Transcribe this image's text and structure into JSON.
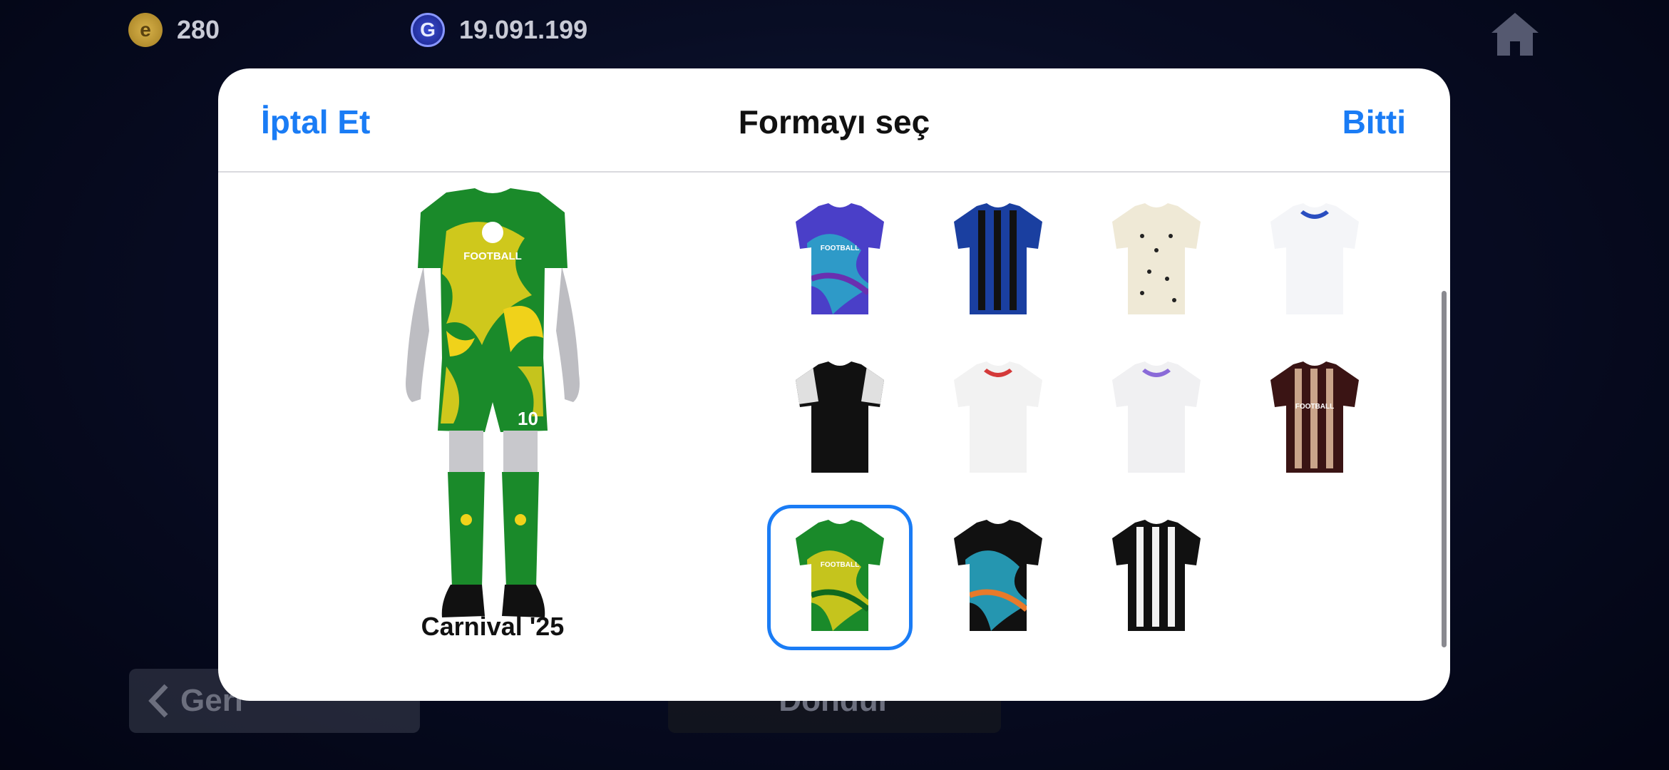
{
  "topbar": {
    "coins": {
      "icon": "efootball-coin-icon",
      "value": "280",
      "glyph": "e"
    },
    "gp": {
      "icon": "gp-coin-icon",
      "value": "19.091.199",
      "glyph": "G"
    },
    "home_icon": "home-icon"
  },
  "background_buttons": {
    "back_label": "Geri",
    "center_label": "Döndür"
  },
  "dialog": {
    "title": "Formayı seç",
    "cancel_label": "İptal Et",
    "done_label": "Bitti",
    "accent_color": "#1a7cf5"
  },
  "preview": {
    "kit_name": "Carnival '25",
    "shirt_number": "10",
    "sponsor_text": "FOOTBALL"
  },
  "kits": [
    {
      "id": "kit-1",
      "colors": [
        "#4a3fc8",
        "#27b2c8",
        "#6a2fb0"
      ],
      "pattern": "waves",
      "sponsor": "FOOTBALL",
      "selected": false
    },
    {
      "id": "kit-2",
      "colors": [
        "#1a3fa0",
        "#111111",
        "#2a5ad0"
      ],
      "pattern": "stripes",
      "sponsor": "",
      "selected": false
    },
    {
      "id": "kit-3",
      "colors": [
        "#efe9d6",
        "#222222",
        "#d8cfb0"
      ],
      "pattern": "dots",
      "sponsor": "",
      "selected": false
    },
    {
      "id": "kit-4",
      "colors": [
        "#f4f5f8",
        "#2a4ec0",
        "#e6e8ee"
      ],
      "pattern": "plain",
      "sponsor": "",
      "selected": false
    },
    {
      "id": "kit-5",
      "colors": [
        "#111111",
        "#e0e0e0",
        "#222222"
      ],
      "pattern": "sleeves",
      "sponsor": "",
      "selected": false
    },
    {
      "id": "kit-6",
      "colors": [
        "#f2f2f2",
        "#d43a3a",
        "#e6e6e6"
      ],
      "pattern": "plain",
      "sponsor": "",
      "selected": false
    },
    {
      "id": "kit-7",
      "colors": [
        "#f0f0f2",
        "#8a6ad8",
        "#e0e0e6"
      ],
      "pattern": "plain",
      "sponsor": "",
      "selected": false
    },
    {
      "id": "kit-8",
      "colors": [
        "#3a1414",
        "#c9a48a",
        "#2a0c0c"
      ],
      "pattern": "stripes",
      "sponsor": "FOOTBALL",
      "selected": false
    },
    {
      "id": "kit-9",
      "colors": [
        "#1a8a2a",
        "#f0d21a",
        "#0f6a1e"
      ],
      "pattern": "waves",
      "sponsor": "FOOTBALL",
      "selected": true
    },
    {
      "id": "kit-10",
      "colors": [
        "#111111",
        "#2ab8d8",
        "#e87a2a"
      ],
      "pattern": "waves",
      "sponsor": "",
      "selected": false
    },
    {
      "id": "kit-11",
      "colors": [
        "#111111",
        "#f2f2f2",
        "#d8b22a"
      ],
      "pattern": "stripes",
      "sponsor": "",
      "selected": false
    }
  ]
}
